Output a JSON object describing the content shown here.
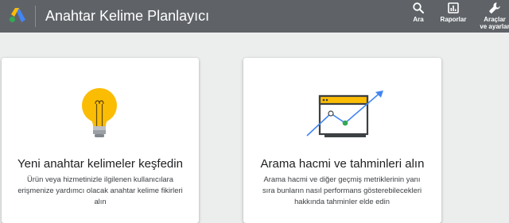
{
  "app": {
    "title": "Anahtar Kelime Planlayıcı",
    "logo_icon": "google-ads-logo-icon"
  },
  "toolbar": {
    "search_label": "Ara",
    "reports_label": "Raporlar",
    "settings_label_line1": "Araçlar",
    "settings_label_line2": "ve ayarlar"
  },
  "cards": {
    "discover": {
      "icon": "lightbulb-icon",
      "title": "Yeni anahtar kelimeler keşfedin",
      "description": "Ürün veya hizmetinizle ilgilenen kullanıcılara erişmenize yardımcı olacak anahtar kelime fikirleri alın"
    },
    "forecast": {
      "icon": "trend-chart-icon",
      "title": "Arama hacmi ve tahminleri alın",
      "description": "Arama hacmi ve diğer geçmiş metriklerinin yanı sıra bunların nasıl performans gösterebilecekleri hakkında tahminler elde edin"
    }
  },
  "colors": {
    "topbar": "#5f6368",
    "background": "#eceded",
    "bulb_yellow": "#fbbc04",
    "trend_blue": "#4285f4",
    "trend_green": "#34a853"
  }
}
